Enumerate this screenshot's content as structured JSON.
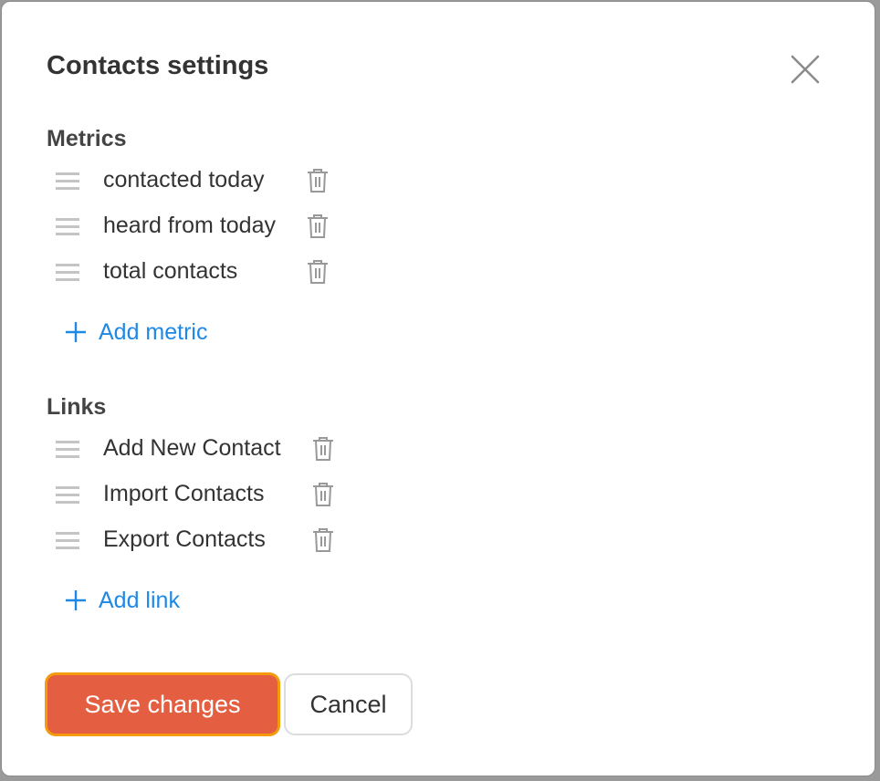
{
  "dialog": {
    "title": "Contacts settings"
  },
  "metrics": {
    "heading": "Metrics",
    "items": [
      {
        "label": "contacted today"
      },
      {
        "label": "heard from today"
      },
      {
        "label": "total contacts"
      }
    ],
    "add_label": "Add metric"
  },
  "links": {
    "heading": "Links",
    "items": [
      {
        "label": "Add New Contact"
      },
      {
        "label": "Import Contacts"
      },
      {
        "label": "Export Contacts"
      }
    ],
    "add_label": "Add link"
  },
  "footer": {
    "save_label": "Save changes",
    "cancel_label": "Cancel"
  },
  "colors": {
    "accent": "#1e88e5",
    "primary_button": "#e45f41",
    "focus_ring": "#f59a0b"
  },
  "icons": {
    "close": "close-icon",
    "drag": "drag-handle-icon",
    "delete": "trash-icon",
    "add": "plus-icon"
  }
}
